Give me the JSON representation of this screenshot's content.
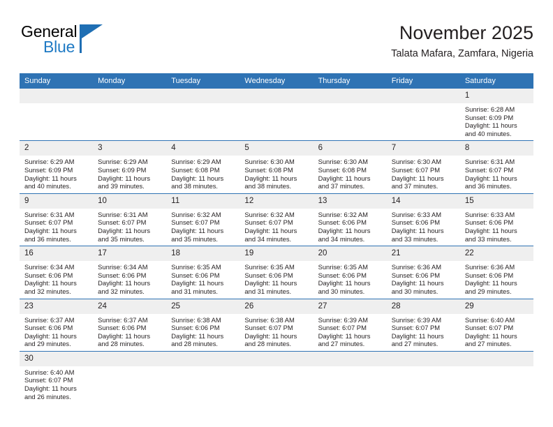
{
  "brand": {
    "name_part1": "General",
    "name_part2": "Blue",
    "flag_color": "#1f6fb4",
    "blue_color": "#1f7ac4"
  },
  "header": {
    "month_title": "November 2025",
    "location": "Talata Mafara, Zamfara, Nigeria"
  },
  "theme": {
    "header_blue": "#2f73b4",
    "row_divider": "#2f73b4",
    "daynum_band": "#efefef",
    "text": "#231f20"
  },
  "calendar": {
    "weekday_headers": [
      "Sunday",
      "Monday",
      "Tuesday",
      "Wednesday",
      "Thursday",
      "Friday",
      "Saturday"
    ],
    "weeks": [
      [
        {
          "day": "",
          "sunrise": "",
          "sunset": "",
          "daylight_line1": "",
          "daylight_line2": "",
          "empty": true
        },
        {
          "day": "",
          "sunrise": "",
          "sunset": "",
          "daylight_line1": "",
          "daylight_line2": "",
          "empty": true
        },
        {
          "day": "",
          "sunrise": "",
          "sunset": "",
          "daylight_line1": "",
          "daylight_line2": "",
          "empty": true
        },
        {
          "day": "",
          "sunrise": "",
          "sunset": "",
          "daylight_line1": "",
          "daylight_line2": "",
          "empty": true
        },
        {
          "day": "",
          "sunrise": "",
          "sunset": "",
          "daylight_line1": "",
          "daylight_line2": "",
          "empty": true
        },
        {
          "day": "",
          "sunrise": "",
          "sunset": "",
          "daylight_line1": "",
          "daylight_line2": "",
          "empty": true
        },
        {
          "day": "1",
          "sunrise": "Sunrise: 6:28 AM",
          "sunset": "Sunset: 6:09 PM",
          "daylight_line1": "Daylight: 11 hours",
          "daylight_line2": "and 40 minutes.",
          "empty": false
        }
      ],
      [
        {
          "day": "2",
          "sunrise": "Sunrise: 6:29 AM",
          "sunset": "Sunset: 6:09 PM",
          "daylight_line1": "Daylight: 11 hours",
          "daylight_line2": "and 40 minutes.",
          "empty": false
        },
        {
          "day": "3",
          "sunrise": "Sunrise: 6:29 AM",
          "sunset": "Sunset: 6:09 PM",
          "daylight_line1": "Daylight: 11 hours",
          "daylight_line2": "and 39 minutes.",
          "empty": false
        },
        {
          "day": "4",
          "sunrise": "Sunrise: 6:29 AM",
          "sunset": "Sunset: 6:08 PM",
          "daylight_line1": "Daylight: 11 hours",
          "daylight_line2": "and 38 minutes.",
          "empty": false
        },
        {
          "day": "5",
          "sunrise": "Sunrise: 6:30 AM",
          "sunset": "Sunset: 6:08 PM",
          "daylight_line1": "Daylight: 11 hours",
          "daylight_line2": "and 38 minutes.",
          "empty": false
        },
        {
          "day": "6",
          "sunrise": "Sunrise: 6:30 AM",
          "sunset": "Sunset: 6:08 PM",
          "daylight_line1": "Daylight: 11 hours",
          "daylight_line2": "and 37 minutes.",
          "empty": false
        },
        {
          "day": "7",
          "sunrise": "Sunrise: 6:30 AM",
          "sunset": "Sunset: 6:07 PM",
          "daylight_line1": "Daylight: 11 hours",
          "daylight_line2": "and 37 minutes.",
          "empty": false
        },
        {
          "day": "8",
          "sunrise": "Sunrise: 6:31 AM",
          "sunset": "Sunset: 6:07 PM",
          "daylight_line1": "Daylight: 11 hours",
          "daylight_line2": "and 36 minutes.",
          "empty": false
        }
      ],
      [
        {
          "day": "9",
          "sunrise": "Sunrise: 6:31 AM",
          "sunset": "Sunset: 6:07 PM",
          "daylight_line1": "Daylight: 11 hours",
          "daylight_line2": "and 36 minutes.",
          "empty": false
        },
        {
          "day": "10",
          "sunrise": "Sunrise: 6:31 AM",
          "sunset": "Sunset: 6:07 PM",
          "daylight_line1": "Daylight: 11 hours",
          "daylight_line2": "and 35 minutes.",
          "empty": false
        },
        {
          "day": "11",
          "sunrise": "Sunrise: 6:32 AM",
          "sunset": "Sunset: 6:07 PM",
          "daylight_line1": "Daylight: 11 hours",
          "daylight_line2": "and 35 minutes.",
          "empty": false
        },
        {
          "day": "12",
          "sunrise": "Sunrise: 6:32 AM",
          "sunset": "Sunset: 6:07 PM",
          "daylight_line1": "Daylight: 11 hours",
          "daylight_line2": "and 34 minutes.",
          "empty": false
        },
        {
          "day": "13",
          "sunrise": "Sunrise: 6:32 AM",
          "sunset": "Sunset: 6:06 PM",
          "daylight_line1": "Daylight: 11 hours",
          "daylight_line2": "and 34 minutes.",
          "empty": false
        },
        {
          "day": "14",
          "sunrise": "Sunrise: 6:33 AM",
          "sunset": "Sunset: 6:06 PM",
          "daylight_line1": "Daylight: 11 hours",
          "daylight_line2": "and 33 minutes.",
          "empty": false
        },
        {
          "day": "15",
          "sunrise": "Sunrise: 6:33 AM",
          "sunset": "Sunset: 6:06 PM",
          "daylight_line1": "Daylight: 11 hours",
          "daylight_line2": "and 33 minutes.",
          "empty": false
        }
      ],
      [
        {
          "day": "16",
          "sunrise": "Sunrise: 6:34 AM",
          "sunset": "Sunset: 6:06 PM",
          "daylight_line1": "Daylight: 11 hours",
          "daylight_line2": "and 32 minutes.",
          "empty": false
        },
        {
          "day": "17",
          "sunrise": "Sunrise: 6:34 AM",
          "sunset": "Sunset: 6:06 PM",
          "daylight_line1": "Daylight: 11 hours",
          "daylight_line2": "and 32 minutes.",
          "empty": false
        },
        {
          "day": "18",
          "sunrise": "Sunrise: 6:35 AM",
          "sunset": "Sunset: 6:06 PM",
          "daylight_line1": "Daylight: 11 hours",
          "daylight_line2": "and 31 minutes.",
          "empty": false
        },
        {
          "day": "19",
          "sunrise": "Sunrise: 6:35 AM",
          "sunset": "Sunset: 6:06 PM",
          "daylight_line1": "Daylight: 11 hours",
          "daylight_line2": "and 31 minutes.",
          "empty": false
        },
        {
          "day": "20",
          "sunrise": "Sunrise: 6:35 AM",
          "sunset": "Sunset: 6:06 PM",
          "daylight_line1": "Daylight: 11 hours",
          "daylight_line2": "and 30 minutes.",
          "empty": false
        },
        {
          "day": "21",
          "sunrise": "Sunrise: 6:36 AM",
          "sunset": "Sunset: 6:06 PM",
          "daylight_line1": "Daylight: 11 hours",
          "daylight_line2": "and 30 minutes.",
          "empty": false
        },
        {
          "day": "22",
          "sunrise": "Sunrise: 6:36 AM",
          "sunset": "Sunset: 6:06 PM",
          "daylight_line1": "Daylight: 11 hours",
          "daylight_line2": "and 29 minutes.",
          "empty": false
        }
      ],
      [
        {
          "day": "23",
          "sunrise": "Sunrise: 6:37 AM",
          "sunset": "Sunset: 6:06 PM",
          "daylight_line1": "Daylight: 11 hours",
          "daylight_line2": "and 29 minutes.",
          "empty": false
        },
        {
          "day": "24",
          "sunrise": "Sunrise: 6:37 AM",
          "sunset": "Sunset: 6:06 PM",
          "daylight_line1": "Daylight: 11 hours",
          "daylight_line2": "and 28 minutes.",
          "empty": false
        },
        {
          "day": "25",
          "sunrise": "Sunrise: 6:38 AM",
          "sunset": "Sunset: 6:06 PM",
          "daylight_line1": "Daylight: 11 hours",
          "daylight_line2": "and 28 minutes.",
          "empty": false
        },
        {
          "day": "26",
          "sunrise": "Sunrise: 6:38 AM",
          "sunset": "Sunset: 6:07 PM",
          "daylight_line1": "Daylight: 11 hours",
          "daylight_line2": "and 28 minutes.",
          "empty": false
        },
        {
          "day": "27",
          "sunrise": "Sunrise: 6:39 AM",
          "sunset": "Sunset: 6:07 PM",
          "daylight_line1": "Daylight: 11 hours",
          "daylight_line2": "and 27 minutes.",
          "empty": false
        },
        {
          "day": "28",
          "sunrise": "Sunrise: 6:39 AM",
          "sunset": "Sunset: 6:07 PM",
          "daylight_line1": "Daylight: 11 hours",
          "daylight_line2": "and 27 minutes.",
          "empty": false
        },
        {
          "day": "29",
          "sunrise": "Sunrise: 6:40 AM",
          "sunset": "Sunset: 6:07 PM",
          "daylight_line1": "Daylight: 11 hours",
          "daylight_line2": "and 27 minutes.",
          "empty": false
        }
      ],
      [
        {
          "day": "30",
          "sunrise": "Sunrise: 6:40 AM",
          "sunset": "Sunset: 6:07 PM",
          "daylight_line1": "Daylight: 11 hours",
          "daylight_line2": "and 26 minutes.",
          "empty": false
        },
        {
          "day": "",
          "sunrise": "",
          "sunset": "",
          "daylight_line1": "",
          "daylight_line2": "",
          "empty": true
        },
        {
          "day": "",
          "sunrise": "",
          "sunset": "",
          "daylight_line1": "",
          "daylight_line2": "",
          "empty": true
        },
        {
          "day": "",
          "sunrise": "",
          "sunset": "",
          "daylight_line1": "",
          "daylight_line2": "",
          "empty": true
        },
        {
          "day": "",
          "sunrise": "",
          "sunset": "",
          "daylight_line1": "",
          "daylight_line2": "",
          "empty": true
        },
        {
          "day": "",
          "sunrise": "",
          "sunset": "",
          "daylight_line1": "",
          "daylight_line2": "",
          "empty": true
        },
        {
          "day": "",
          "sunrise": "",
          "sunset": "",
          "daylight_line1": "",
          "daylight_line2": "",
          "empty": true
        }
      ]
    ]
  }
}
